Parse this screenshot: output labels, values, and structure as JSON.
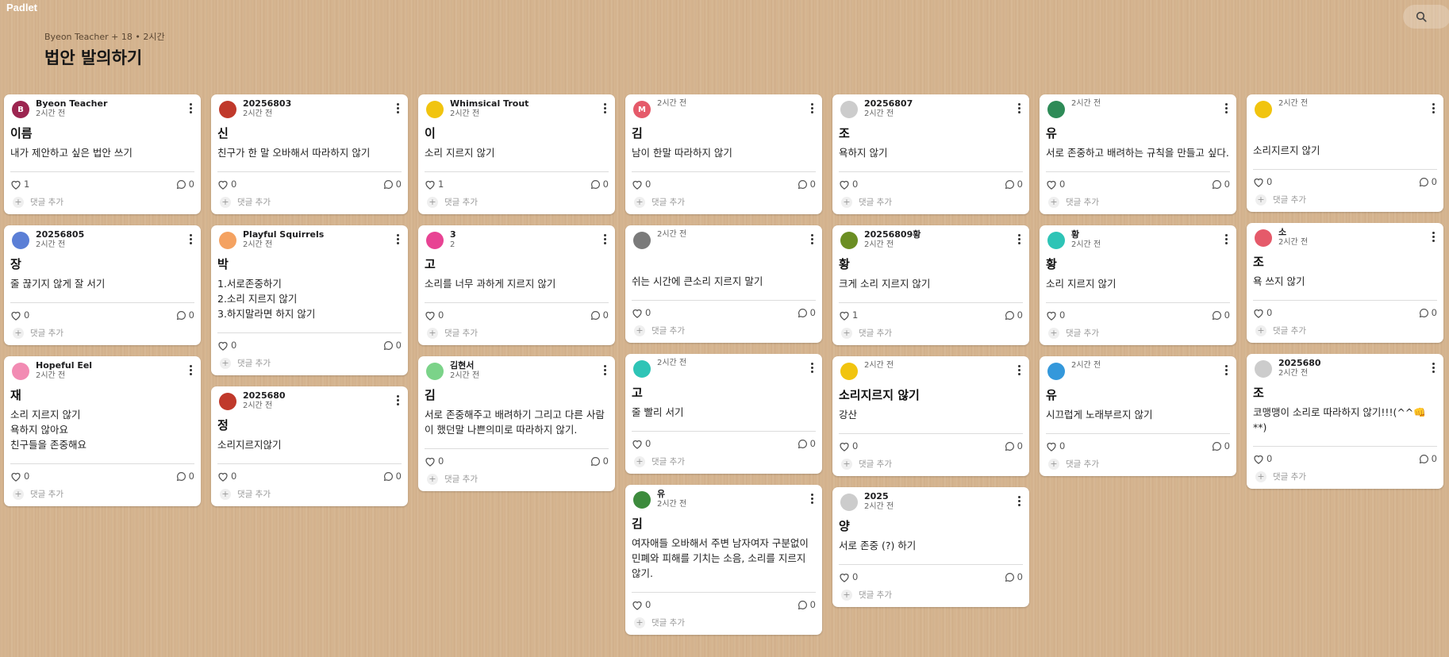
{
  "app": {
    "logo": "Padlet"
  },
  "board": {
    "meta": "Byeon Teacher + 18 • 2시간",
    "title": "법안 발의하기"
  },
  "ui": {
    "comment_add": "댓글 추가"
  },
  "columns": [
    [
      {
        "author": "Byeon Teacher",
        "time": "2시간 전",
        "subject": "이름",
        "body": "내가 제안하고 싶은 법안 쓰기",
        "likes": "1",
        "comments": "0",
        "avatar_color": "#9c2550",
        "avatar_text": "B"
      },
      {
        "author": "20256805",
        "time": "2시간 전",
        "subject": "장",
        "body": "줄 끊기지 않게 잘 서기",
        "likes": "0",
        "comments": "0",
        "avatar_color": "#5b7fd6",
        "avatar_text": ""
      },
      {
        "author": "Hopeful Eel",
        "time": "2시간 전",
        "subject": "재",
        "body": "소리 지르지 않기\n욕하지 않아요\n친구들을 존중해요\n ",
        "likes": "0",
        "comments": "0",
        "avatar_color": "#f28bb3",
        "avatar_text": ""
      }
    ],
    [
      {
        "author": "20256803",
        "time": "2시간 전",
        "subject": "신",
        "body": "친구가 한 말 오바해서 따라하지 않기",
        "likes": "0",
        "comments": "0",
        "avatar_color": "#c0392b",
        "avatar_text": ""
      },
      {
        "author": "Playful Squirrels",
        "time": "2시간 전",
        "subject": "박",
        "body": "1.서로존중하기\n2.소리 지르지 않기\n3.하지말라면 하지 않기",
        "likes": "0",
        "comments": "0",
        "avatar_color": "#f4a261",
        "avatar_text": ""
      },
      {
        "author": "2025680",
        "time": "2시간 전",
        "subject": "정",
        "body": "소리지르지않기",
        "likes": "0",
        "comments": "0",
        "avatar_color": "#c0392b",
        "avatar_text": ""
      }
    ],
    [
      {
        "author": "Whimsical Trout",
        "time": "2시간 전",
        "subject": "이",
        "body": "소리 지르지 않기",
        "likes": "1",
        "comments": "0",
        "avatar_color": "#f1c40f",
        "avatar_text": ""
      },
      {
        "author": "3",
        "time": "2",
        "subject": "고",
        "body": "소리를 너무 과하게 지르지 않기",
        "likes": "0",
        "comments": "0",
        "avatar_color": "#e84393",
        "avatar_text": ""
      },
      {
        "author": "김현서",
        "time": "2시간 전",
        "subject": "김",
        "body": "서로 존중해주고 배려하기 그리고 다른 사람이 했던말 나쁜의미로 따라하지 않기.",
        "likes": "0",
        "comments": "0",
        "avatar_color": "#7bd389",
        "avatar_text": ""
      }
    ],
    [
      {
        "author": "",
        "time": "2시간 전",
        "subject": "김",
        "body": "남이 한말 따라하지 않기",
        "likes": "0",
        "comments": "0",
        "avatar_color": "#e55a6a",
        "avatar_text": "M"
      },
      {
        "author": "",
        "time": "2시간 전",
        "subject": "",
        "body": "쉬는 시간에 큰소리 지르지 말기",
        "likes": "0",
        "comments": "0",
        "avatar_color": "#7a7a7a",
        "avatar_text": ""
      },
      {
        "author": "",
        "time": "2시간 전",
        "subject": "고",
        "body": "줄 빨리 서기",
        "likes": "0",
        "comments": "0",
        "avatar_color": "#2ec4b6",
        "avatar_text": ""
      },
      {
        "author": "유",
        "time": "2시간 전",
        "subject": "김",
        "body": "여자애들 오바해서 주변 남자여자 구분없이 민폐와 피해를 기치는 소음, 소리를 지르지 않기.",
        "likes": "0",
        "comments": "0",
        "avatar_color": "#3d8b3d",
        "avatar_text": ""
      }
    ],
    [
      {
        "author": "20256807",
        "time": "2시간 전",
        "subject": "조",
        "body": "욕하지 않기",
        "likes": "0",
        "comments": "0",
        "avatar_color": "#cccccc",
        "avatar_text": ""
      },
      {
        "author": "20256809황",
        "time": "2시간 전",
        "subject": "황",
        "body": "크게 소리 지르지 않기",
        "likes": "1",
        "comments": "0",
        "avatar_color": "#6b8e23",
        "avatar_text": ""
      },
      {
        "author": "",
        "time": "2시간 전",
        "subject": "소리지르지 않기",
        "body": "강산",
        "likes": "0",
        "comments": "0",
        "avatar_color": "#f1c40f",
        "avatar_text": ""
      },
      {
        "author": "2025",
        "time": "2시간 전",
        "subject": "양",
        "body": "서로 존중 (?) 하기",
        "likes": "0",
        "comments": "0",
        "avatar_color": "#cccccc",
        "avatar_text": ""
      }
    ],
    [
      {
        "author": "",
        "time": "2시간 전",
        "subject": "유",
        "body": "서로 존중하고 배려하는 규칙을 만들고 싶다.",
        "likes": "0",
        "comments": "0",
        "avatar_color": "#2e8b57",
        "avatar_text": ""
      },
      {
        "author": "황",
        "time": "2시간 전",
        "subject": "황",
        "body": "소리 지르지 않기",
        "likes": "0",
        "comments": "0",
        "avatar_color": "#2ec4b6",
        "avatar_text": ""
      },
      {
        "author": "",
        "time": "2시간 전",
        "subject": "유",
        "body": "시끄럽게 노래부르지 않기",
        "likes": "0",
        "comments": "0",
        "avatar_color": "#3498db",
        "avatar_text": ""
      }
    ],
    [
      {
        "author": "",
        "time": "2시간 전",
        "subject": "",
        "body": "소리지르지 않기",
        "likes": "0",
        "comments": "0",
        "avatar_color": "#f1c40f",
        "avatar_text": ""
      },
      {
        "author": "소",
        "time": "2시간 전",
        "subject": "조",
        "body": "욕 쓰지 않기",
        "likes": "0",
        "comments": "0",
        "avatar_color": "#e55a6a",
        "avatar_text": ""
      },
      {
        "author": "2025680",
        "time": "2시간 전",
        "subject": "조",
        "body": "코맹맹이 소리로 따라하지 않기!!!(^^👊**)",
        "likes": "0",
        "comments": "0",
        "avatar_color": "#cccccc",
        "avatar_text": ""
      }
    ]
  ]
}
